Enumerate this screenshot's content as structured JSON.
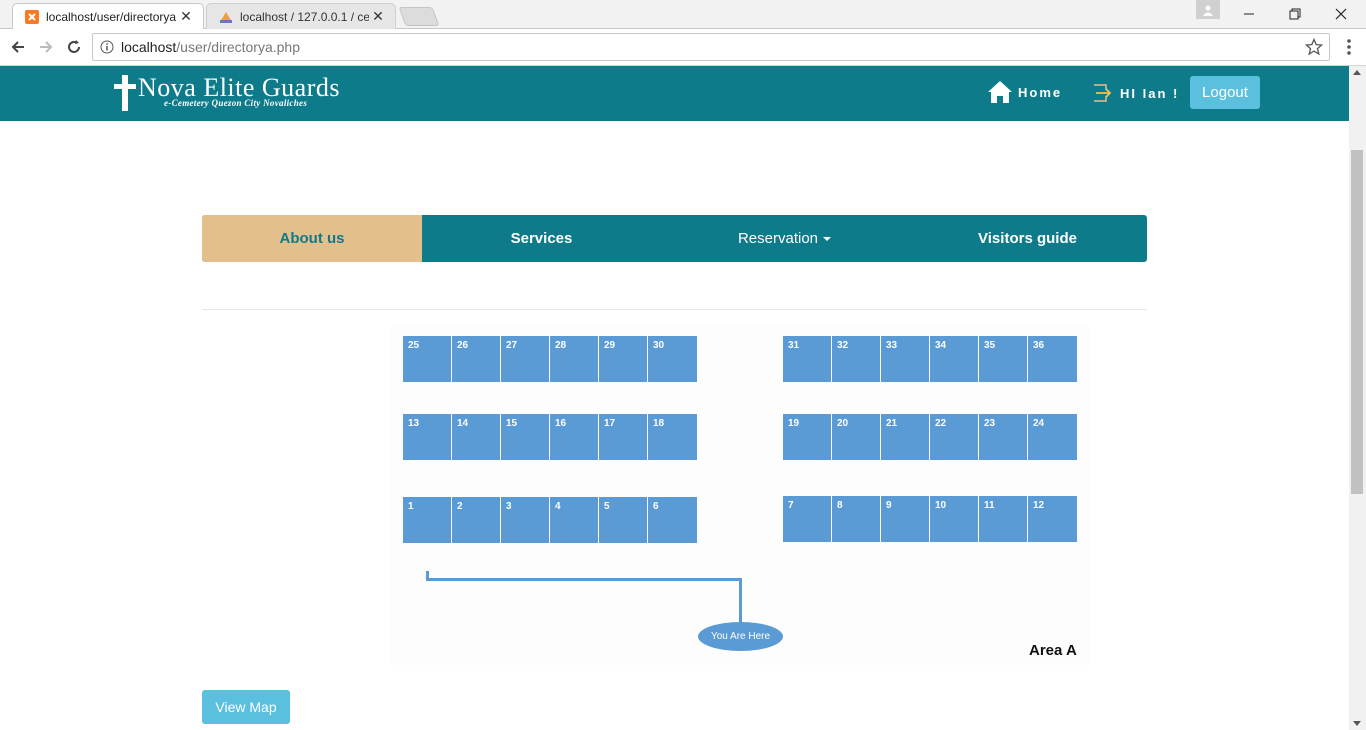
{
  "browser": {
    "tabs": [
      {
        "title": "localhost/user/directorya",
        "icon": "xampp-icon"
      },
      {
        "title": "localhost / 127.0.0.1 / cer",
        "icon": "phpmyadmin-icon"
      }
    ],
    "url_host": "localhost",
    "url_path": "/user/directorya.php"
  },
  "header": {
    "logo_title": "Nova Elite Guards",
    "logo_subtitle": "e-Cemetery Quezon City Novaliches",
    "home_label": "Home",
    "greeting": "HI Ian !",
    "logout_label": "Logout"
  },
  "menu": {
    "about": "About us",
    "services": "Services",
    "reservation": "Reservation",
    "visitors": "Visitors guide"
  },
  "map": {
    "blocks": [
      {
        "lots": [
          "25",
          "26",
          "27",
          "28",
          "29",
          "30"
        ]
      },
      {
        "lots": [
          "31",
          "32",
          "33",
          "34",
          "35",
          "36"
        ]
      },
      {
        "lots": [
          "13",
          "14",
          "15",
          "16",
          "17",
          "18"
        ]
      },
      {
        "lots": [
          "19",
          "20",
          "21",
          "22",
          "23",
          "24"
        ]
      },
      {
        "lots": [
          "1",
          "2",
          "3",
          "4",
          "5",
          "6"
        ]
      },
      {
        "lots": [
          "7",
          "8",
          "9",
          "10",
          "11",
          "12"
        ]
      }
    ],
    "you_are_here": "You Are Here",
    "area_label": "Area A",
    "lot_color": "#5b9bd5"
  },
  "view_map_label": "View Map",
  "colors": {
    "header": "#0e7b8b",
    "active_menu": "#e3bf8c",
    "button": "#5bc0de"
  }
}
